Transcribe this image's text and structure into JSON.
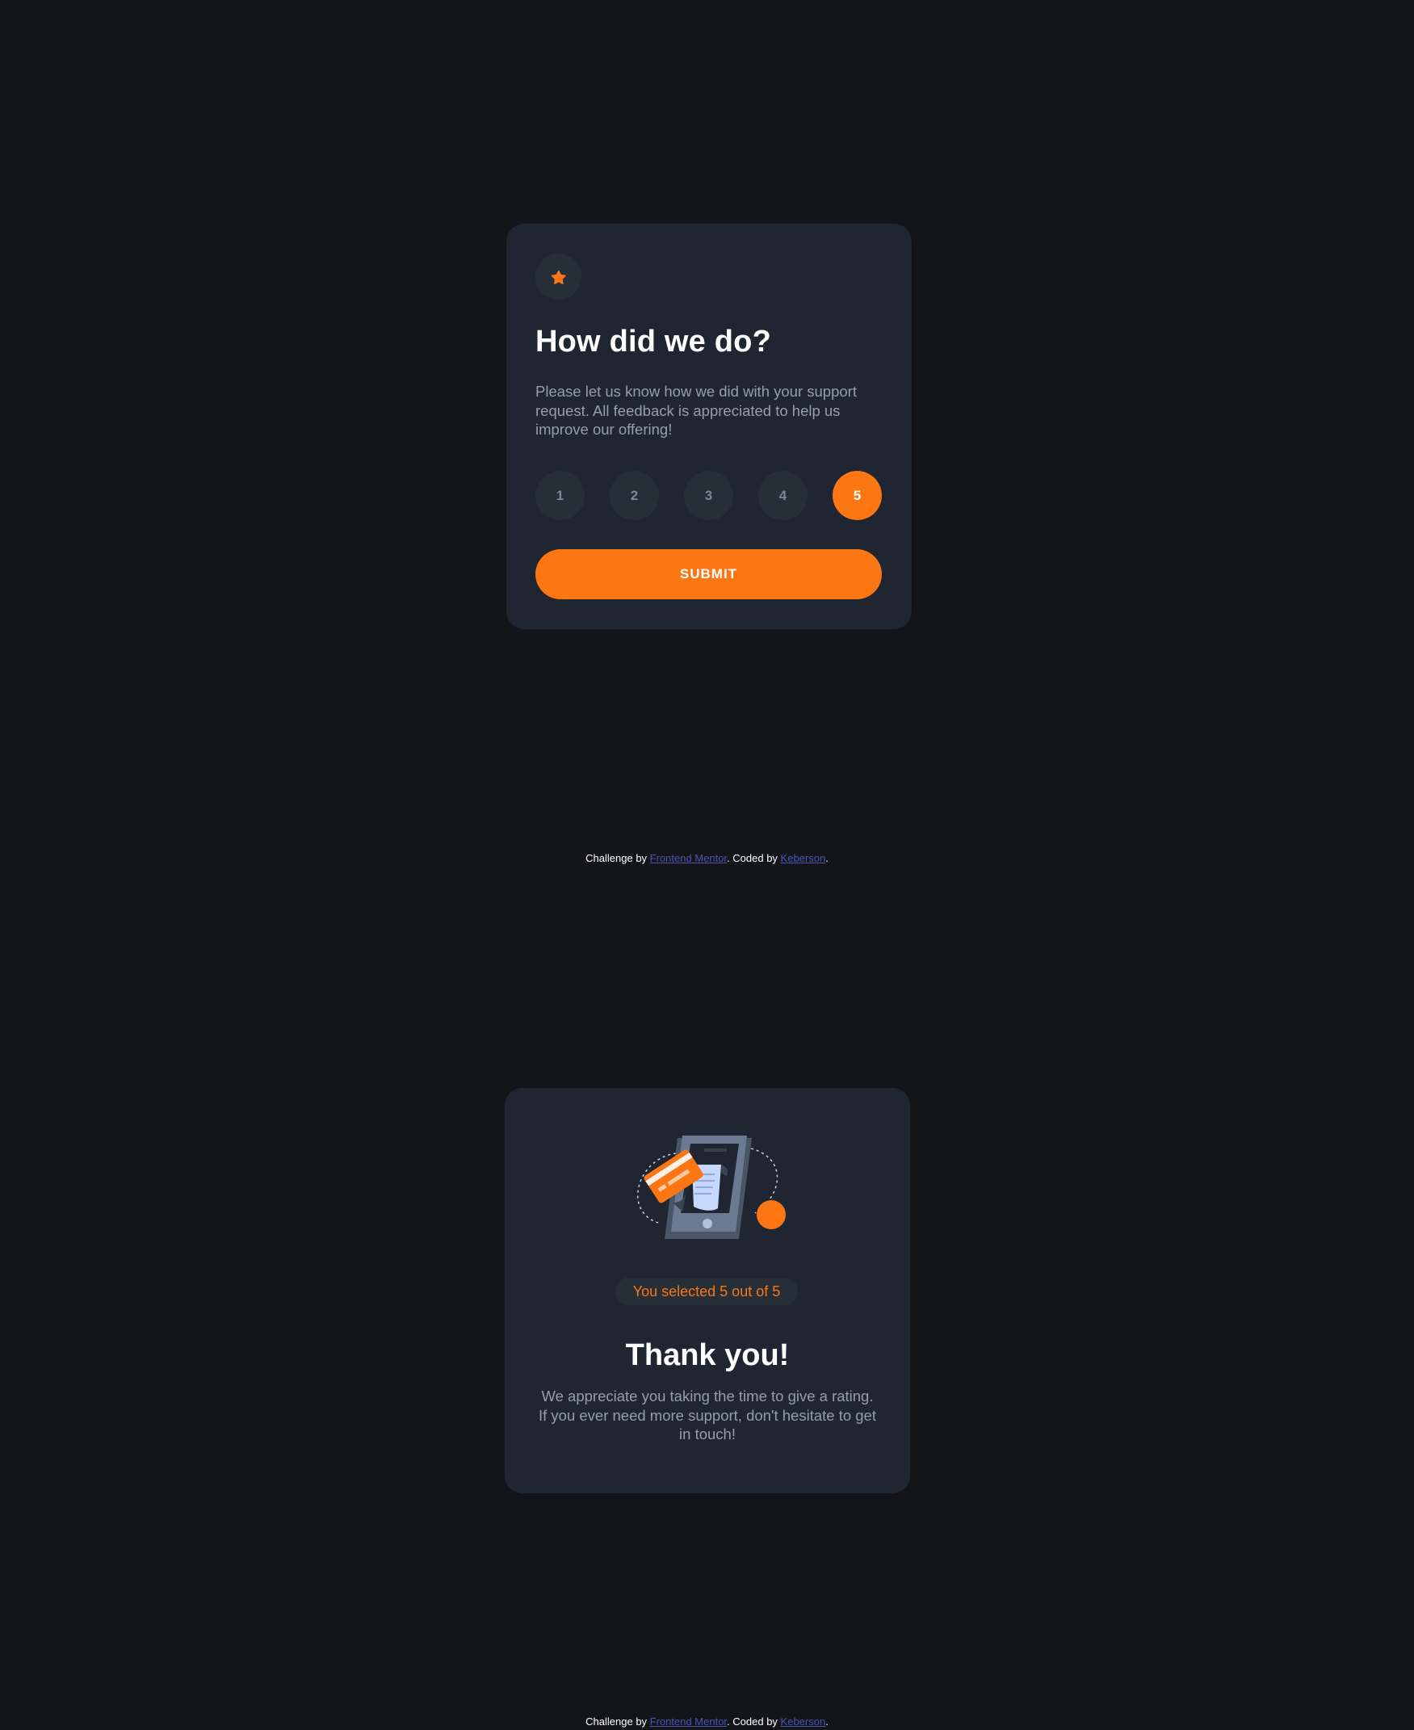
{
  "rating_card": {
    "title": "How did we do?",
    "description": "Please let us know how we did with your support request. All feedback is appreciated to help us improve our offering!",
    "ratings": [
      "1",
      "2",
      "3",
      "4",
      "5"
    ],
    "selected_rating": "5",
    "submit_label": "SUBMIT"
  },
  "thankyou_card": {
    "selected_text": "You selected 5 out of 5",
    "title": "Thank you!",
    "description": "We appreciate you taking the time to give a rating. If you ever need more support, don't hesitate to get in touch!"
  },
  "attribution": {
    "prefix": "Challenge by ",
    "link1_label": "Frontend Mentor",
    "middle": ". Coded by ",
    "link2_label": "Keberson",
    "suffix": "."
  },
  "colors": {
    "background": "#131518",
    "card": "#1f2531",
    "accent": "#fc7614",
    "muted_text": "#959eac",
    "link": "#4a55b8"
  },
  "icons": {
    "star": "star-icon",
    "illustration": "payment-phone-illustration"
  }
}
